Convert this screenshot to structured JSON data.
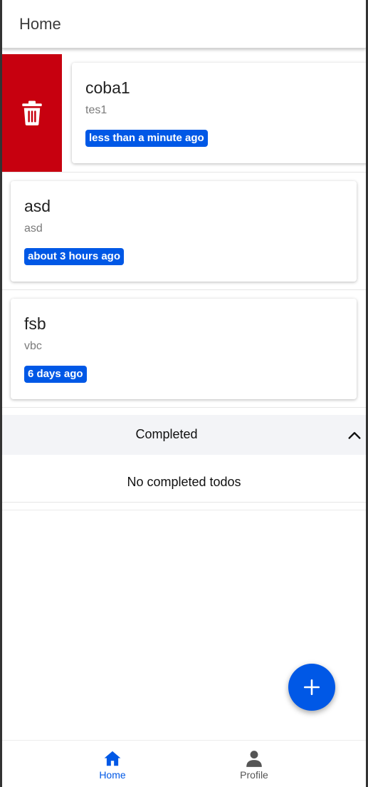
{
  "header": {
    "title": "Home"
  },
  "todos": [
    {
      "title": "coba1",
      "description": "tes1",
      "time": "less than a minute ago"
    },
    {
      "title": "asd",
      "description": "asd",
      "time": "about 3 hours ago"
    },
    {
      "title": "fsb",
      "description": "vbc",
      "time": "6 days ago"
    }
  ],
  "completed": {
    "label": "Completed",
    "empty_text": "No completed todos"
  },
  "nav": {
    "home_label": "Home",
    "profile_label": "Profile"
  },
  "icons": {
    "delete": "trash-icon",
    "expand": "chevron-up-icon",
    "add": "plus-icon",
    "home": "home-icon",
    "profile": "person-icon"
  },
  "colors": {
    "accent": "#0058e6",
    "delete": "#c7000f"
  }
}
